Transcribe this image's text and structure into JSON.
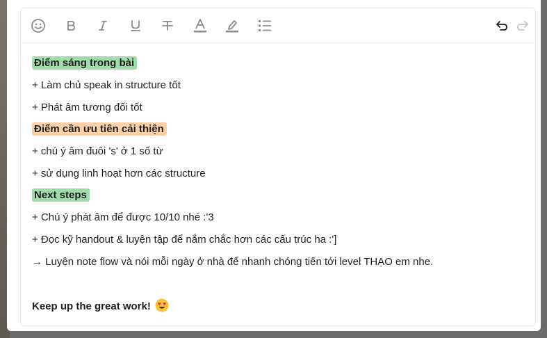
{
  "toolbar": {
    "buttons": [
      {
        "name": "emoji-icon"
      },
      {
        "name": "bold-icon"
      },
      {
        "name": "italic-icon"
      },
      {
        "name": "underline-icon"
      },
      {
        "name": "strikethrough-icon"
      },
      {
        "name": "text-color-icon"
      },
      {
        "name": "highlight-icon"
      },
      {
        "name": "bullet-list-icon"
      },
      {
        "name": "undo-icon"
      },
      {
        "name": "redo-icon"
      }
    ]
  },
  "content": {
    "strengths_heading": "Điểm sáng trong bài",
    "strength_1": "+ Làm chủ speak in structure tốt",
    "strength_2": "+ Phát âm tương đối tốt",
    "improve_heading": "Điểm cần ưu tiên cải thiện",
    "improve_1": "+ chú ý âm đuôi 's' ở 1 số từ",
    "improve_2": "+ sử dụng linh hoạt hơn các structure",
    "next_heading": "Next steps",
    "next_1": "+ Chú ý phát âm để được 10/10 nhé :'3",
    "next_2": "+ Đọc kỹ handout & luyện tập để nắm chắc hơn các cấu trúc ha :']",
    "next_3": "→ Luyện note flow và nói mỗi ngày ở nhà để nhanh chóng tiến tới level THẠO em nhe.",
    "closing": "Keep up the great work!",
    "closing_emoji": "smiling-face-with-heart-eyes"
  },
  "colors": {
    "highlight_green": "#9fdca9",
    "highlight_orange": "#fad0a6",
    "icon_gray": "#8a8a8a",
    "icon_dark": "#1f1f1f",
    "icon_disabled": "#c8c8c8"
  }
}
